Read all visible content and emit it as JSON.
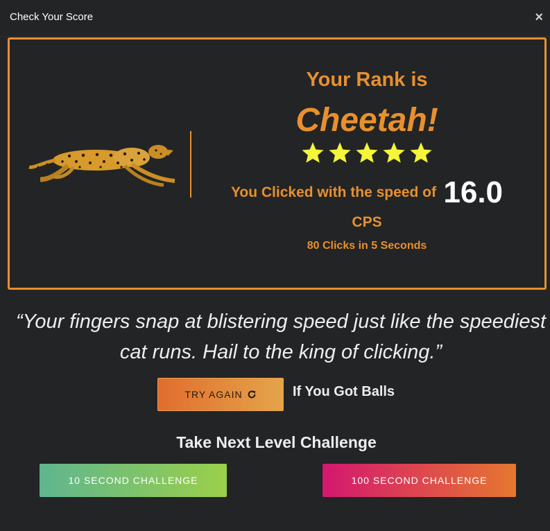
{
  "header": {
    "title": "Check Your Score",
    "close_icon": "×"
  },
  "result": {
    "rank_title": "Your Rank is",
    "rank_name": "Cheetah!",
    "stars": 5,
    "star_color": "#f5f53a",
    "speed_label": "You Clicked with the speed of",
    "speed_value": "16.0",
    "unit": "CPS",
    "clicks_summary": "80 Clicks in 5 Seconds",
    "image_icon": "cheetah-running"
  },
  "quote": {
    "line1": "“Your fingers snap at blistering speed just like the speediest",
    "line2": "cat runs. Hail to the king of clicking.”"
  },
  "actions": {
    "try_again_label": "TRY AGAIN",
    "try_again_icon": "refresh-icon",
    "balls_text": "If You Got Balls",
    "next_title": "Take Next Level Challenge",
    "challenge_10": "10 SECOND CHALLENGE",
    "challenge_100": "100 SECOND CHALLENGE"
  },
  "colors": {
    "accent": "#e8902e",
    "background": "#232425"
  }
}
